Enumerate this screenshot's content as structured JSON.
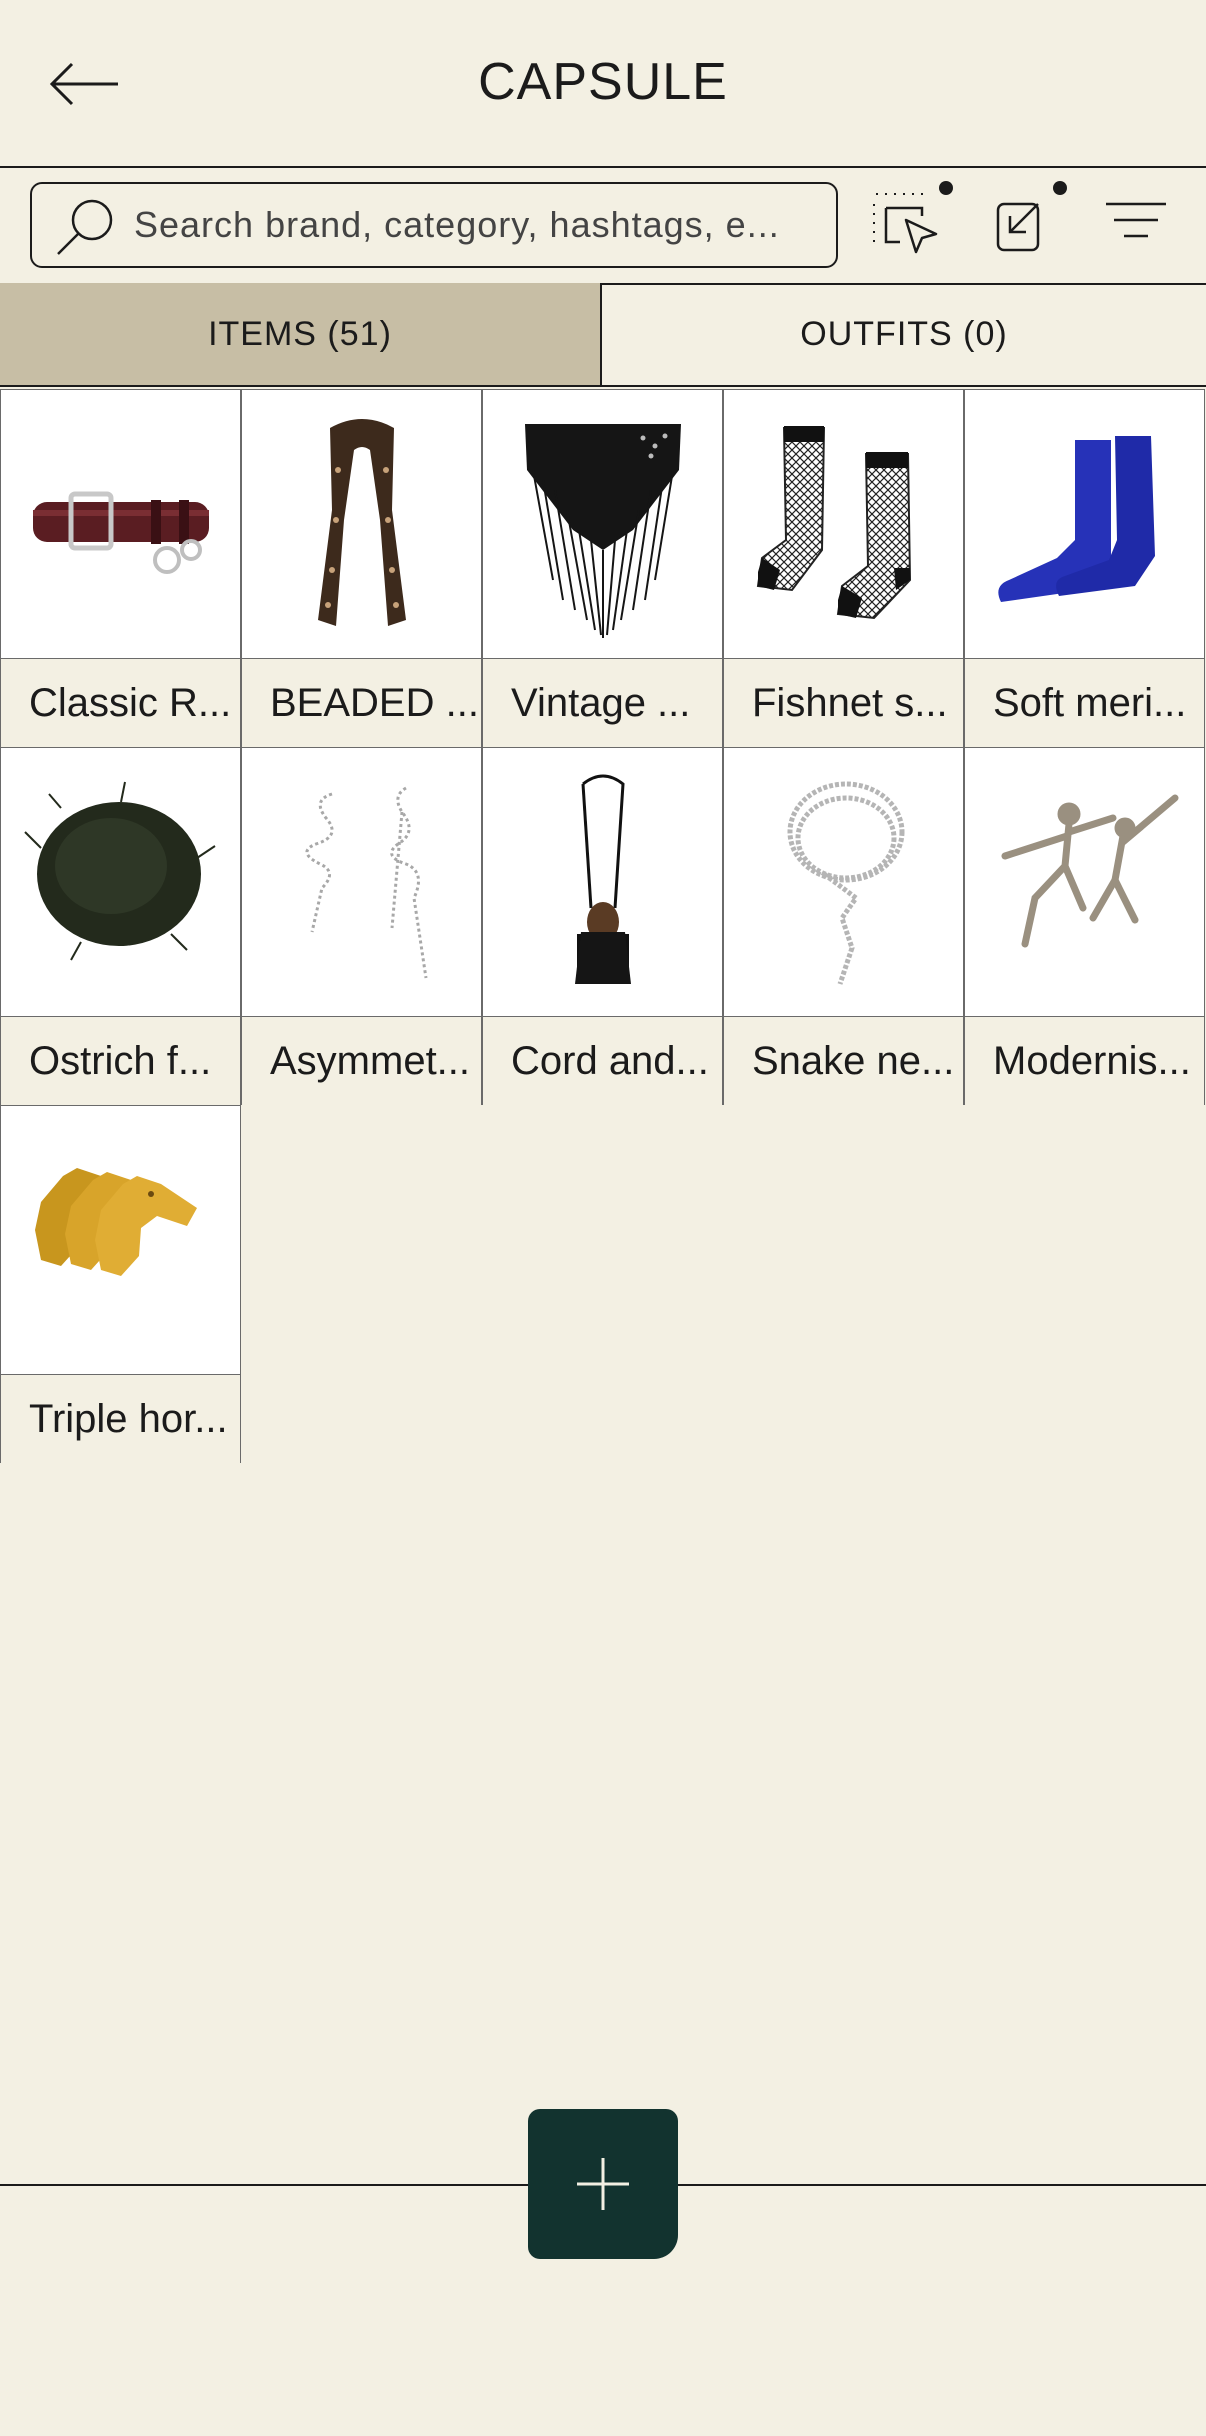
{
  "header": {
    "title": "CAPSULE"
  },
  "search": {
    "placeholder": "Search brand, category, hashtags, e..."
  },
  "tabs": [
    {
      "label": "ITEMS (51)",
      "active": true
    },
    {
      "label": "OUTFITS (0)",
      "active": false
    }
  ],
  "items": [
    {
      "label": "Classic R...",
      "icon": "belt"
    },
    {
      "label": "BEADED ...",
      "icon": "beaded-scarf"
    },
    {
      "label": "Vintage ...",
      "icon": "fringe-shawl"
    },
    {
      "label": "Fishnet s...",
      "icon": "fishnet-socks"
    },
    {
      "label": "Soft meri...",
      "icon": "blue-socks"
    },
    {
      "label": "Ostrich f...",
      "icon": "ostrich-feather"
    },
    {
      "label": "Asymmet...",
      "icon": "asymmetric-earrings"
    },
    {
      "label": "Cord and...",
      "icon": "cord-necklace"
    },
    {
      "label": "Snake ne...",
      "icon": "snake-necklace"
    },
    {
      "label": "Modernis...",
      "icon": "modernist-brooch"
    },
    {
      "label": "Triple hor...",
      "icon": "horse-brooch"
    }
  ],
  "colors": {
    "background": "#f3f0e3",
    "active_tab": "#c7bea5",
    "fab": "#12332f",
    "text": "#1b1b1b"
  }
}
